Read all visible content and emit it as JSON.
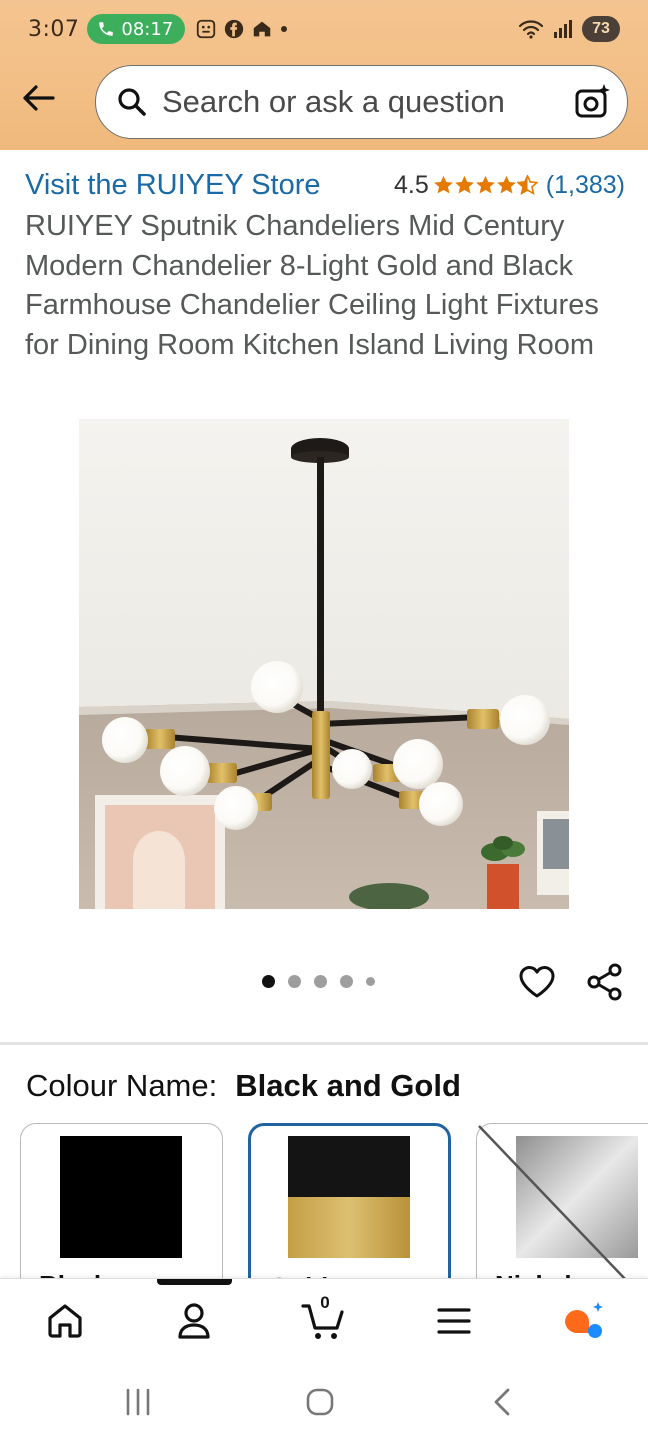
{
  "status_bar": {
    "time": "3:07",
    "call_duration": "08:17",
    "battery": "73"
  },
  "search": {
    "placeholder": "Search or ask a question"
  },
  "product": {
    "store_link": "Visit the RUIYEY Store",
    "rating": "4.5",
    "stars": 4.5,
    "review_count": "(1,383)",
    "title": "RUIYEY Sputnik Chandeliers Mid Century Modern Chandelier 8-Light Gold and Black Farmhouse Chandelier Ceiling Light Fixtures for Dining Room Kitchen Island Living Room"
  },
  "gallery": {
    "image_count": 5,
    "active_index": 0
  },
  "colour": {
    "label": "Colour Name:",
    "selected": "Black and Gold",
    "options": [
      {
        "caption": "Black",
        "selected": false
      },
      {
        "caption": "Gold",
        "selected": true
      },
      {
        "caption": "Nickel",
        "selected": false
      }
    ]
  },
  "bottom_nav": {
    "items": [
      "home-icon",
      "account-icon",
      "cart-icon",
      "menu-icon",
      "rufus-icon"
    ],
    "active": "account-icon",
    "cart_count": "0"
  },
  "colors": {
    "header_bg": "#f2bf86",
    "link": "#1b6aa5",
    "star": "#e67a00",
    "selected_border": "#2162a1",
    "gold": "#c9a44a"
  }
}
